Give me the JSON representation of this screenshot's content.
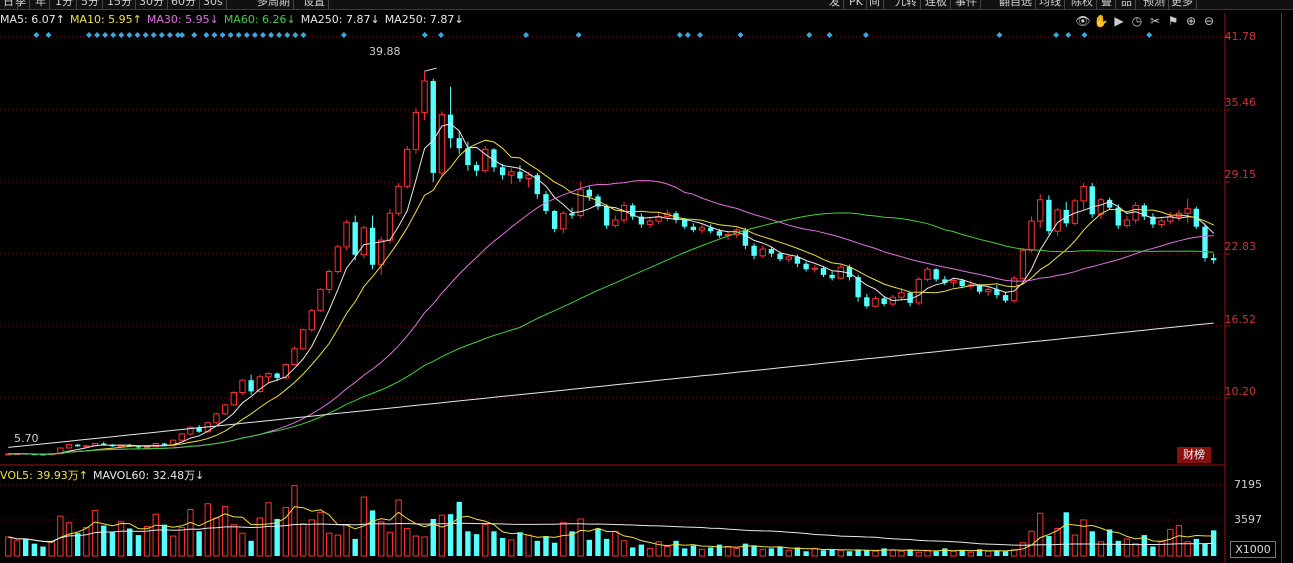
{
  "toolbar": {
    "left_items": [
      "日",
      "季",
      "年",
      "1分",
      "5分",
      "15分",
      "30分",
      "60分",
      "30s",
      "多周期",
      "设置"
    ],
    "right_items": [
      "发",
      "PK",
      "间",
      "九转",
      "连板",
      "事件",
      "翻自选",
      "均线",
      "除权",
      "叠",
      "品",
      "预测",
      "更多"
    ]
  },
  "ma_legend": [
    {
      "label": "MA5: 6.07",
      "arrow": "↑",
      "color": "#e8e8e8"
    },
    {
      "label": "MA10: 5.95",
      "arrow": "↑",
      "color": "#f0e040"
    },
    {
      "label": "MA30: 5.95",
      "arrow": "↓",
      "color": "#e070e0"
    },
    {
      "label": "MA60: 6.26",
      "arrow": "↓",
      "color": "#40d040"
    },
    {
      "label": "MA250: 7.87",
      "arrow": "↓",
      "color": "#e8e8e8"
    },
    {
      "label": "MA250: 7.87",
      "arrow": "↓",
      "color": "#e8e8e8"
    }
  ],
  "vol_legend": [
    {
      "label": "VOL5: 39.93万",
      "arrow": "↑",
      "color": "#f0e040"
    },
    {
      "label": "MAVOL60: 32.48万",
      "arrow": "↓",
      "color": "#e8e8e8"
    }
  ],
  "tool_icons": [
    "eye-icon",
    "hand-icon",
    "play-icon",
    "clock-icon",
    "scissors-icon",
    "flag-icon",
    "zoom-in-icon",
    "zoom-out-icon"
  ],
  "tool_glyphs": [
    "👁",
    "✋",
    "▶",
    "◷",
    "✂",
    "⚑",
    "⊕",
    "⊖"
  ],
  "price_labels": [
    "41.78",
    "35.46",
    "29.15",
    "22.83",
    "16.52",
    "10.20"
  ],
  "volume_labels": [
    "7195",
    "3597"
  ],
  "peak_label": "39.88",
  "low_label": "5.70",
  "caibang_label": "财榜",
  "unit_label": "X1000",
  "colors": {
    "up": "#ff3030",
    "down": "#54ffff",
    "grid": "#7a1010",
    "axis": "#a01010"
  },
  "chart_data": {
    "type": "candlestick",
    "n_bars": 160,
    "ylim": [
      5.0,
      44.0
    ],
    "candles": [
      [
        5.7,
        5.75,
        5.65,
        5.72
      ],
      [
        5.72,
        5.8,
        5.68,
        5.75
      ],
      [
        5.75,
        5.78,
        5.66,
        5.7
      ],
      [
        5.7,
        5.74,
        5.62,
        5.68
      ],
      [
        5.68,
        5.72,
        5.6,
        5.66
      ],
      [
        5.66,
        5.76,
        5.64,
        5.74
      ],
      [
        5.74,
        6.3,
        5.7,
        6.25
      ],
      [
        6.25,
        6.6,
        6.2,
        6.55
      ],
      [
        6.55,
        6.6,
        6.35,
        6.4
      ],
      [
        6.4,
        6.5,
        6.3,
        6.45
      ],
      [
        6.45,
        6.7,
        6.4,
        6.65
      ],
      [
        6.65,
        6.8,
        6.5,
        6.55
      ],
      [
        6.55,
        6.6,
        6.35,
        6.4
      ],
      [
        6.4,
        6.55,
        6.3,
        6.5
      ],
      [
        6.5,
        6.62,
        6.38,
        6.45
      ],
      [
        6.45,
        6.5,
        6.2,
        6.3
      ],
      [
        6.3,
        6.4,
        6.15,
        6.35
      ],
      [
        6.35,
        6.7,
        6.3,
        6.65
      ],
      [
        6.65,
        6.7,
        6.4,
        6.45
      ],
      [
        6.45,
        7.0,
        6.4,
        6.95
      ],
      [
        6.95,
        7.6,
        6.9,
        7.5
      ],
      [
        7.5,
        8.2,
        7.4,
        8.1
      ],
      [
        8.1,
        8.3,
        7.6,
        7.7
      ],
      [
        7.7,
        8.6,
        7.6,
        8.5
      ],
      [
        8.5,
        9.4,
        8.4,
        9.3
      ],
      [
        9.3,
        10.2,
        9.2,
        10.1
      ],
      [
        10.1,
        11.3,
        10.0,
        11.2
      ],
      [
        11.2,
        12.4,
        11.0,
        12.3
      ],
      [
        12.3,
        12.8,
        11.0,
        11.3
      ],
      [
        11.3,
        12.8,
        11.2,
        12.6
      ],
      [
        12.6,
        13.0,
        12.0,
        12.9
      ],
      [
        12.9,
        13.0,
        12.2,
        12.5
      ],
      [
        12.5,
        13.8,
        12.4,
        13.7
      ],
      [
        13.7,
        15.3,
        13.6,
        15.1
      ],
      [
        15.1,
        16.9,
        15.0,
        16.8
      ],
      [
        16.8,
        18.7,
        16.6,
        18.5
      ],
      [
        18.5,
        20.5,
        18.4,
        20.4
      ],
      [
        20.4,
        22.2,
        20.0,
        22.0
      ],
      [
        22.0,
        24.4,
        21.8,
        24.2
      ],
      [
        24.2,
        26.6,
        23.9,
        26.4
      ],
      [
        26.4,
        27.0,
        23.0,
        23.5
      ],
      [
        23.5,
        26.1,
        23.2,
        25.9
      ],
      [
        25.9,
        27.0,
        22.2,
        22.6
      ],
      [
        22.6,
        25.1,
        21.7,
        24.8
      ],
      [
        24.8,
        27.6,
        24.5,
        27.2
      ],
      [
        27.2,
        29.9,
        27.0,
        29.6
      ],
      [
        29.6,
        33.2,
        29.4,
        32.9
      ],
      [
        32.9,
        36.6,
        32.5,
        36.2
      ],
      [
        36.2,
        39.88,
        35.5,
        39.0
      ],
      [
        39.0,
        39.2,
        30.0,
        30.8
      ],
      [
        30.8,
        36.3,
        30.5,
        36.0
      ],
      [
        36.0,
        38.5,
        33.0,
        33.9
      ],
      [
        33.9,
        34.5,
        32.5,
        33.0
      ],
      [
        33.0,
        33.6,
        31.0,
        31.5
      ],
      [
        31.5,
        31.8,
        30.5,
        31.0
      ],
      [
        31.0,
        33.2,
        30.8,
        32.9
      ],
      [
        32.9,
        33.0,
        30.9,
        31.3
      ],
      [
        31.3,
        31.6,
        30.2,
        30.6
      ],
      [
        30.6,
        31.2,
        29.8,
        30.9
      ],
      [
        30.9,
        31.5,
        30.0,
        30.3
      ],
      [
        30.3,
        30.9,
        29.5,
        30.6
      ],
      [
        30.6,
        30.8,
        28.5,
        28.9
      ],
      [
        28.9,
        29.2,
        27.1,
        27.4
      ],
      [
        27.4,
        27.5,
        25.5,
        25.8
      ],
      [
        25.8,
        27.4,
        25.4,
        27.2
      ],
      [
        27.2,
        27.7,
        26.7,
        27.0
      ],
      [
        27.0,
        30.0,
        26.8,
        29.3
      ],
      [
        29.3,
        29.6,
        28.3,
        28.7
      ],
      [
        28.7,
        28.9,
        27.5,
        27.8
      ],
      [
        27.8,
        28.0,
        25.8,
        26.1
      ],
      [
        26.1,
        27.0,
        25.9,
        26.6
      ],
      [
        26.6,
        28.2,
        26.3,
        27.9
      ],
      [
        27.9,
        28.1,
        26.6,
        26.9
      ],
      [
        26.9,
        27.2,
        25.9,
        26.2
      ],
      [
        26.2,
        26.8,
        25.9,
        26.5
      ],
      [
        26.5,
        27.3,
        26.2,
        26.9
      ],
      [
        26.9,
        27.5,
        26.5,
        27.2
      ],
      [
        27.2,
        27.4,
        26.3,
        26.6
      ],
      [
        26.6,
        26.8,
        25.8,
        26.0
      ],
      [
        26.0,
        26.3,
        25.5,
        25.7
      ],
      [
        25.7,
        26.2,
        25.4,
        25.9
      ],
      [
        25.9,
        26.2,
        25.4,
        25.6
      ],
      [
        25.6,
        25.8,
        25.0,
        25.2
      ],
      [
        25.2,
        25.6,
        24.8,
        25.3
      ],
      [
        25.3,
        25.9,
        25.0,
        25.7
      ],
      [
        25.7,
        25.9,
        24.0,
        24.3
      ],
      [
        24.3,
        24.5,
        23.1,
        23.4
      ],
      [
        23.4,
        24.3,
        23.2,
        24.0
      ],
      [
        24.0,
        24.2,
        23.3,
        23.6
      ],
      [
        23.6,
        23.8,
        22.9,
        23.1
      ],
      [
        23.1,
        23.5,
        22.8,
        23.3
      ],
      [
        23.3,
        23.5,
        22.4,
        22.7
      ],
      [
        22.7,
        22.9,
        22.0,
        22.2
      ],
      [
        22.2,
        22.6,
        21.9,
        22.3
      ],
      [
        22.3,
        22.4,
        21.5,
        21.7
      ],
      [
        21.7,
        22.0,
        21.2,
        21.4
      ],
      [
        21.4,
        22.6,
        21.3,
        22.4
      ],
      [
        22.4,
        22.6,
        21.2,
        21.5
      ],
      [
        21.5,
        21.7,
        19.3,
        19.7
      ],
      [
        19.7,
        20.0,
        18.7,
        18.9
      ],
      [
        18.9,
        19.8,
        18.8,
        19.6
      ],
      [
        19.6,
        19.8,
        18.9,
        19.1
      ],
      [
        19.1,
        19.9,
        18.9,
        19.7
      ],
      [
        19.7,
        20.5,
        19.4,
        20.1
      ],
      [
        20.1,
        20.2,
        18.9,
        19.2
      ],
      [
        19.2,
        21.5,
        19.0,
        21.3
      ],
      [
        21.3,
        22.4,
        21.1,
        22.2
      ],
      [
        22.2,
        22.3,
        21.1,
        21.3
      ],
      [
        21.3,
        21.6,
        20.8,
        21.0
      ],
      [
        21.0,
        21.4,
        20.6,
        21.2
      ],
      [
        21.2,
        21.3,
        20.5,
        20.7
      ],
      [
        20.7,
        21.2,
        20.4,
        20.8
      ],
      [
        20.8,
        20.9,
        20.0,
        20.2
      ],
      [
        20.2,
        20.6,
        19.8,
        20.4
      ],
      [
        20.4,
        20.8,
        19.6,
        19.9
      ],
      [
        19.9,
        20.2,
        19.2,
        19.4
      ],
      [
        19.4,
        21.6,
        19.2,
        21.4
      ],
      [
        21.4,
        24.1,
        21.2,
        23.9
      ],
      [
        23.9,
        26.9,
        23.7,
        26.5
      ],
      [
        26.5,
        28.9,
        25.9,
        28.4
      ],
      [
        28.4,
        28.8,
        25.3,
        25.6
      ],
      [
        25.6,
        27.7,
        25.2,
        27.5
      ],
      [
        27.5,
        28.2,
        26.0,
        26.3
      ],
      [
        26.3,
        28.5,
        26.1,
        28.3
      ],
      [
        28.3,
        29.9,
        27.5,
        29.6
      ],
      [
        29.6,
        29.9,
        26.8,
        27.1
      ],
      [
        27.1,
        28.6,
        26.7,
        28.4
      ],
      [
        28.4,
        28.6,
        27.5,
        27.7
      ],
      [
        27.7,
        28.0,
        25.8,
        26.1
      ],
      [
        26.1,
        27.0,
        25.9,
        26.6
      ],
      [
        26.6,
        28.2,
        26.3,
        27.9
      ],
      [
        27.9,
        28.1,
        26.6,
        26.9
      ],
      [
        26.9,
        27.2,
        25.9,
        26.2
      ],
      [
        26.2,
        26.8,
        25.9,
        26.5
      ],
      [
        26.5,
        27.3,
        26.2,
        26.9
      ],
      [
        26.9,
        27.5,
        26.5,
        27.2
      ],
      [
        27.2,
        28.5,
        26.3,
        27.6
      ],
      [
        27.6,
        27.8,
        25.8,
        26.0
      ],
      [
        26.0,
        26.3,
        22.9,
        23.2
      ],
      [
        23.2,
        23.6,
        22.7,
        23.0
      ]
    ],
    "volumes": [
      2.0,
      1.6,
      1.8,
      1.3,
      1.0,
      1.5,
      4.2,
      3.5,
      2.4,
      3.0,
      4.8,
      3.2,
      2.5,
      3.6,
      2.9,
      2.2,
      3.1,
      4.4,
      3.3,
      2.1,
      3.0,
      4.9,
      2.6,
      5.5,
      4.0,
      5.2,
      3.3,
      2.4,
      1.6,
      4.0,
      5.6,
      3.9,
      5.1,
      7.4,
      3.4,
      3.8,
      4.6,
      2.4,
      2.2,
      3.3,
      1.8,
      6.2,
      4.8,
      3.6,
      2.5,
      5.9,
      2.9,
      2.1,
      2.0,
      3.9,
      4.3,
      4.4,
      5.7,
      2.6,
      2.3,
      3.3,
      2.6,
      1.9,
      1.7,
      2.5,
      2.2,
      1.6,
      2.1,
      1.4,
      3.5,
      2.6,
      3.9,
      1.7,
      2.9,
      1.8,
      2.6,
      1.6,
      0.9,
      1.2,
      0.8,
      1.5,
      1.0,
      1.6,
      0.8,
      1.1,
      0.7,
      0.9,
      1.2,
      1.0,
      0.8,
      1.3,
      1.1,
      0.7,
      0.8,
      1.0,
      0.6,
      0.9,
      0.5,
      0.8,
      0.6,
      0.7,
      0.6,
      0.5,
      0.7,
      0.6,
      0.5,
      0.8,
      0.6,
      0.5,
      0.7,
      0.4,
      0.6,
      0.5,
      0.8,
      0.5,
      0.6,
      0.4,
      0.7,
      0.5,
      0.6,
      0.5,
      0.7,
      1.4,
      2.6,
      4.5,
      2.1,
      2.9,
      4.6,
      2.2,
      3.8,
      2.6,
      1.5,
      2.8,
      1.6,
      1.8,
      1.3,
      2.2,
      1.0,
      1.5,
      2.8,
      3.2,
      1.5,
      1.8,
      1.3,
      2.7,
      1.4,
      2.0,
      1.6,
      1.2,
      1.4,
      2.4,
      1.5,
      2.9,
      4.1,
      3.4,
      2.5,
      1.6,
      2.2,
      1.5,
      1.3,
      1.7,
      1.9,
      2.1,
      1.8,
      2.0,
      3.4,
      1.6
    ],
    "signal_positions": [
      8,
      11,
      21,
      23,
      25,
      27,
      29,
      31,
      33,
      35,
      37,
      39,
      41,
      43,
      44,
      47,
      50,
      52,
      54,
      56,
      58,
      60,
      62,
      64,
      66,
      68,
      70,
      72,
      74,
      84,
      104,
      108,
      129,
      142,
      167,
      169,
      172,
      182,
      199,
      204,
      213,
      246,
      260,
      263,
      267,
      283
    ],
    "ma_periods": [
      5,
      10,
      30,
      60,
      250
    ]
  }
}
